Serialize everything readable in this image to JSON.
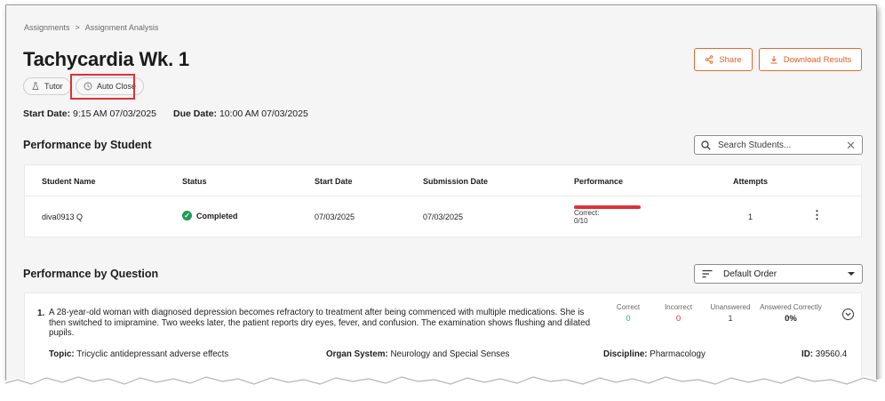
{
  "breadcrumb": {
    "items": [
      "Assignments",
      "Assignment Analysis"
    ],
    "separator": ">"
  },
  "assignment": {
    "title": "Tachycardia Wk. 1",
    "chips": {
      "tutor": "Tutor",
      "auto_close": "Auto Close"
    },
    "start_date_label": "Start Date:",
    "start_date_value": "9:15 AM 07/03/2025",
    "due_date_label": "Due Date:",
    "due_date_value": "10:00 AM 07/03/2025"
  },
  "actions": {
    "share": "Share",
    "download": "Download Results"
  },
  "student_section": {
    "title": "Performance by Student",
    "search_placeholder": "Search Students...",
    "columns": [
      "Student Name",
      "Status",
      "Start Date",
      "Submission Date",
      "Performance",
      "Attempts"
    ],
    "rows": [
      {
        "student_name": "diva0913 Q",
        "status": "Completed",
        "start_date": "07/03/2025",
        "submission_date": "07/03/2025",
        "performance_text": "Correct: 0/10",
        "performance_fraction": 0,
        "attempts": "1"
      }
    ]
  },
  "question_section": {
    "title": "Performance by Question",
    "sort_value": "Default Order",
    "questions": [
      {
        "number": "1.",
        "text": "A 28-year-old woman with diagnosed depression becomes refractory to treatment after being commenced with multiple medications. She is then switched to imipramine. Two weeks later, the patient reports dry eyes, fever, and confusion. The examination shows flushing and dilated pupils.",
        "stats": {
          "correct_label": "Correct",
          "correct_value": "0",
          "incorrect_label": "Incorrect",
          "incorrect_value": "0",
          "unanswered_label": "Unanswered",
          "unanswered_value": "1",
          "answered_label": "Answered Correctly",
          "answered_value": "0%"
        },
        "topic_label": "Topic:",
        "topic_value": "Tricyclic antidepressant adverse effects",
        "organ_label": "Organ System:",
        "organ_value": "Neurology and Special Senses",
        "discipline_label": "Discipline:",
        "discipline_value": "Pharmacology",
        "id_label": "ID:",
        "id_value": "39560.4"
      }
    ]
  },
  "colors": {
    "accent": "#e0602a",
    "success": "#1f9d55",
    "danger": "#d8323a",
    "teal": "#2aa889"
  }
}
